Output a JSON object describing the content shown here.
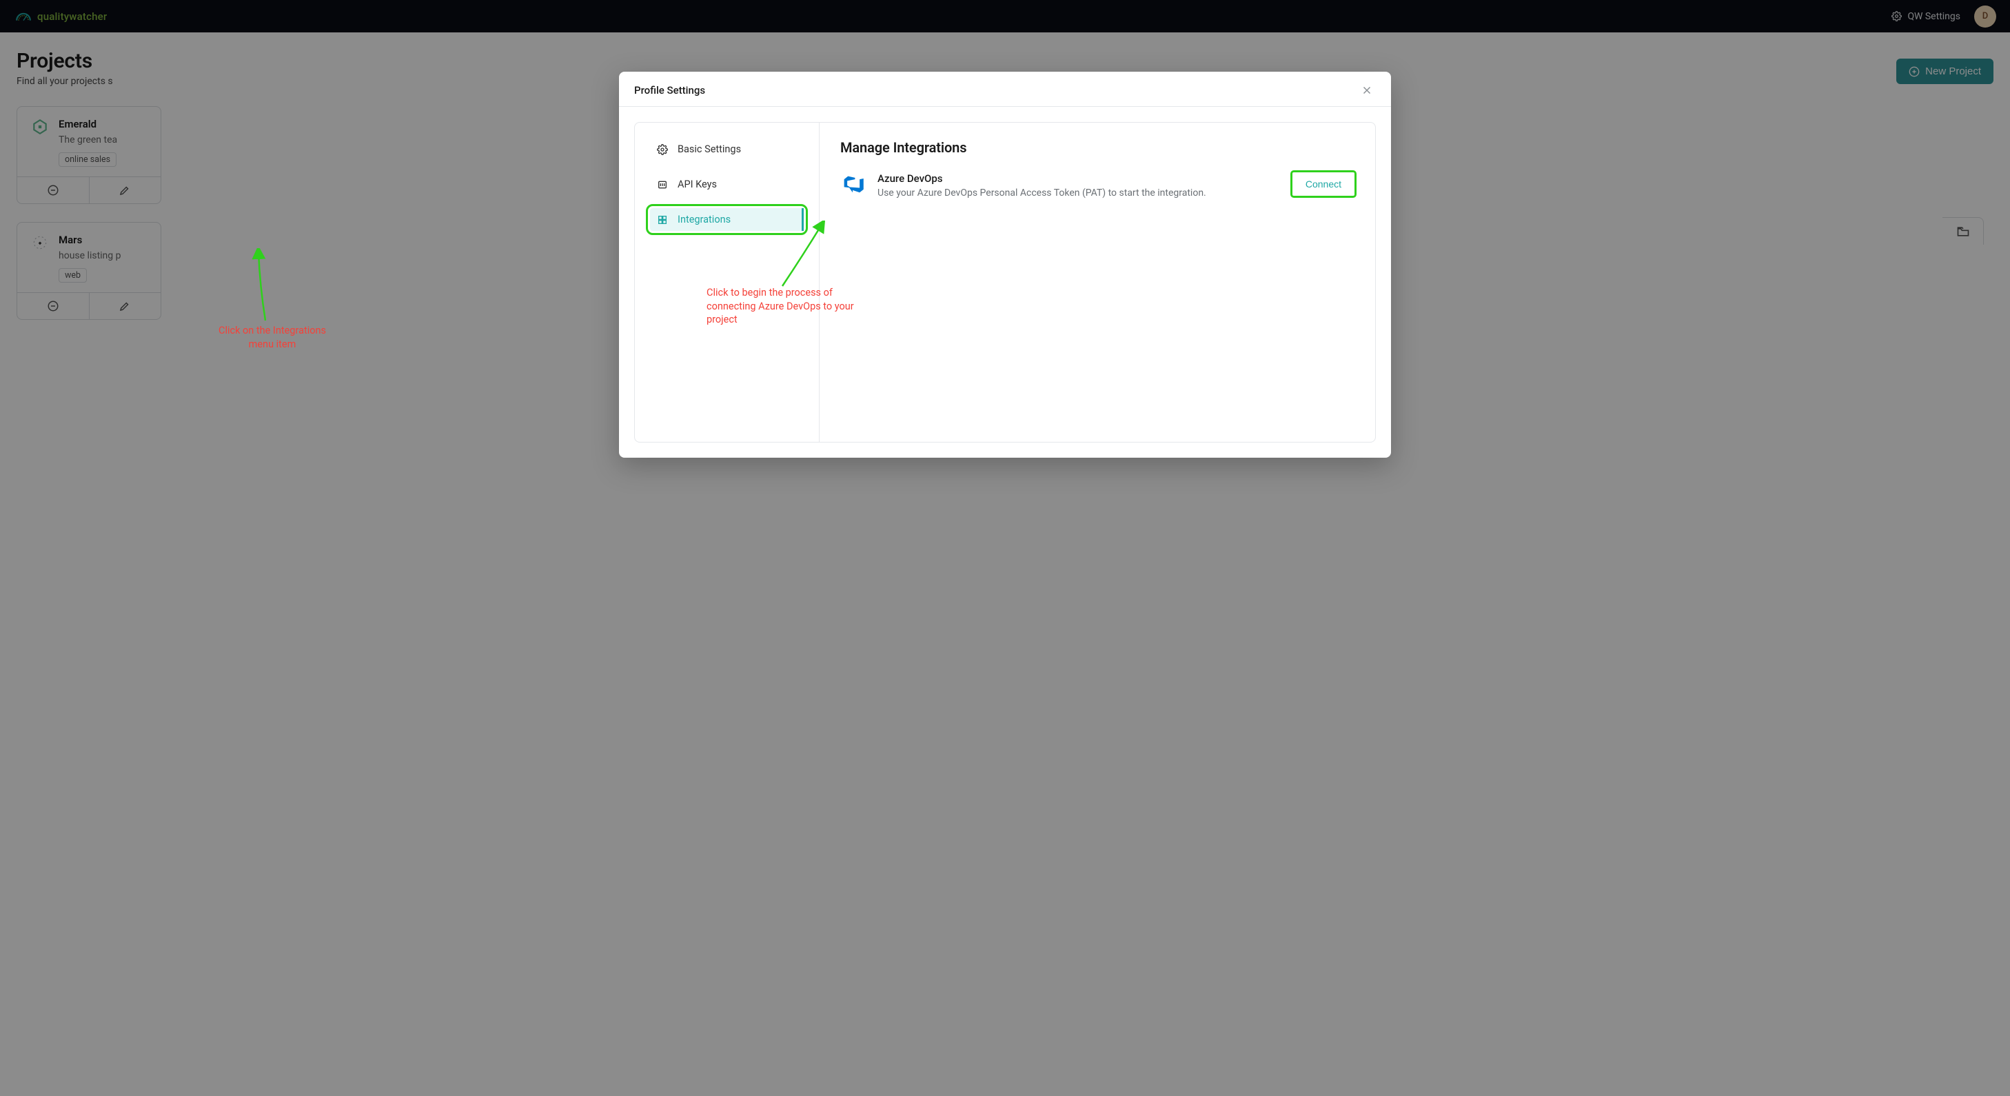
{
  "header": {
    "logo_text": "qualitywatcher",
    "settings_label": "QW Settings",
    "avatar_initial": "D"
  },
  "page": {
    "title": "Projects",
    "subtitle": "Find all your projects s",
    "new_project_btn": "New Project"
  },
  "projects": [
    {
      "name": "Emerald",
      "desc": "The green tea",
      "tag": "online sales"
    },
    {
      "name": "Mars",
      "desc": "house listing p",
      "tag": "web"
    }
  ],
  "modal": {
    "title": "Profile Settings",
    "sidebar": {
      "items": [
        {
          "label": "Basic Settings",
          "icon": "gear"
        },
        {
          "label": "API Keys",
          "icon": "key"
        },
        {
          "label": "Integrations",
          "icon": "grid",
          "active": true
        }
      ]
    },
    "main": {
      "heading": "Manage Integrations",
      "integration": {
        "name": "Azure DevOps",
        "desc": "Use your Azure DevOps Personal Access Token (PAT) to start the integration.",
        "connect_label": "Connect"
      }
    }
  },
  "annotations": {
    "left": "Click on the Integrations menu item",
    "right": "Click to begin the process of connecting Azure DevOps to your project"
  }
}
